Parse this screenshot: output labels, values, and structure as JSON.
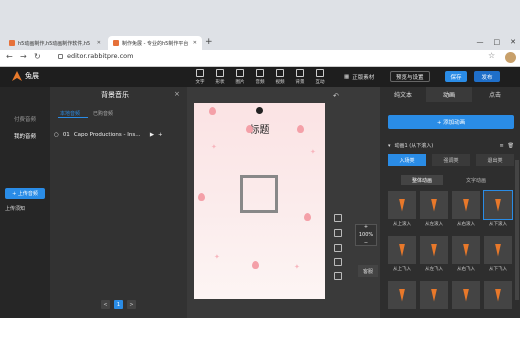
{
  "browser": {
    "tabs": [
      {
        "title": "h5动画制作,h5动画制作软件,h5",
        "active": false
      },
      {
        "title": "制作免展 - 专业的h5制作平台",
        "active": true
      }
    ],
    "new_tab": "+",
    "url": "editor.rabbitpre.com",
    "window_controls": [
      "—",
      "□",
      "✕"
    ]
  },
  "app": {
    "logo_text": "兔展",
    "toolbar": [
      "文字",
      "形状",
      "图片",
      "音频",
      "视频",
      "背景",
      "互动",
      "组件"
    ],
    "genuine_label": "正版素材",
    "preview_label": "预览与设置",
    "save_label": "保存",
    "publish_label": "发布"
  },
  "left_nav": {
    "items": [
      "付费音频",
      "我的音频"
    ],
    "upload_button": "+ 上传音频",
    "upload_notice": "上传须知"
  },
  "music_panel": {
    "title": "背景音乐",
    "close": "×",
    "tabs": [
      "本地音频",
      "已购音频"
    ],
    "rows": [
      {
        "index": "01",
        "name": "Capo Productions - Ins..."
      }
    ],
    "pager": [
      "<",
      "1",
      ">"
    ]
  },
  "canvas": {
    "title_text": "标题",
    "zoom": "100%",
    "service_label": "客服"
  },
  "right_panel": {
    "tabs": [
      "纯文本",
      "动画",
      "点击"
    ],
    "add_animation": "+ 添加动画",
    "animation_item": "动画1 (从下滚入)",
    "subtabs": [
      "入场类",
      "强调类",
      "退出类"
    ],
    "group_tabs": [
      "整体动画",
      "文字动画"
    ],
    "thumbs": [
      "从上滚入",
      "从左滚入",
      "从右滚入",
      "从下滚入",
      "从上飞入",
      "从左飞入",
      "从右飞入",
      "从下飞入",
      "",
      "",
      "",
      ""
    ]
  },
  "colors": {
    "accent": "#2a8ce6",
    "brand": "#e87a2c"
  }
}
